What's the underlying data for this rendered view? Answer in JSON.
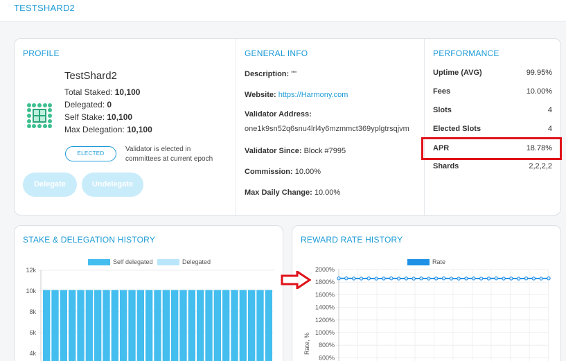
{
  "header": {
    "title": "TESTSHARD2"
  },
  "profile": {
    "section_title": "PROFILE",
    "name": "TestShard2",
    "total_staked_label": "Total Staked:",
    "total_staked": "10,100",
    "delegated_label": "Delegated:",
    "delegated": "0",
    "self_stake_label": "Self Stake:",
    "self_stake": "10,100",
    "max_delegation_label": "Max Delegation:",
    "max_delegation": "10,100",
    "badge": "ELECTED",
    "badge_note": "Validator is elected in committees at current epoch",
    "delegate_button": "Delegate",
    "undelegate_button": "Undelegate",
    "logo_icon": "validator-logo-icon"
  },
  "general_info": {
    "section_title": "GENERAL INFO",
    "description_label": "Description:",
    "description": "\"\"",
    "website_label": "Website:",
    "website": "https://Harmony.com",
    "validator_address_label": "Validator Address:",
    "validator_address": "one1k9sn52q6snu4lrl4y6mzmmct369yplgtrsqjvm",
    "validator_since_label": "Validator Since:",
    "validator_since": "Block #7995",
    "commission_label": "Commission:",
    "commission": "10.00%",
    "max_daily_change_label": "Max Daily Change:",
    "max_daily_change": "10.00%"
  },
  "performance": {
    "section_title": "PERFORMANCE",
    "rows": [
      {
        "label": "Uptime (AVG)",
        "value": "99.95%"
      },
      {
        "label": "Fees",
        "value": "10.00%"
      },
      {
        "label": "Slots",
        "value": "4"
      },
      {
        "label": "Elected Slots",
        "value": "4"
      },
      {
        "label": "APR",
        "value": "18.78%"
      },
      {
        "label": "Shards",
        "value": "2,2,2,2"
      }
    ]
  },
  "stake_history": {
    "section_title": "STAKE & DELEGATION HISTORY",
    "legend": [
      "Self delegated",
      "Delegated"
    ],
    "colors": {
      "self": "#44bdef",
      "delegated": "#b9e6fb"
    },
    "chart_data": {
      "type": "bar",
      "series": [
        {
          "name": "Self delegated",
          "values": [
            10100,
            10100,
            10100,
            10100,
            10100,
            10100,
            10100,
            10100,
            10100,
            10100,
            10100,
            10100,
            10100,
            10100,
            10100,
            10100,
            10100,
            10100,
            10100,
            10100,
            10100,
            10100,
            10100,
            10100,
            10100,
            10100,
            10100
          ]
        },
        {
          "name": "Delegated",
          "values": [
            0,
            0,
            0,
            0,
            0,
            0,
            0,
            0,
            0,
            0,
            0,
            0,
            0,
            0,
            0,
            0,
            0,
            0,
            0,
            0,
            0,
            0,
            0,
            0,
            0,
            0,
            0
          ]
        }
      ],
      "yticks": [
        "12k",
        "10k",
        "8k",
        "6k",
        "4k"
      ],
      "ylim": [
        0,
        12000
      ],
      "stacked": true
    }
  },
  "reward_history": {
    "section_title": "REWARD RATE HISTORY",
    "legend": [
      "Rate"
    ],
    "colors": {
      "rate": "#1e90e6"
    },
    "chart_data": {
      "type": "line",
      "series": [
        {
          "name": "Rate",
          "values": [
            1860,
            1860,
            1858,
            1857,
            1859,
            1856,
            1858,
            1860,
            1857,
            1858,
            1856,
            1859,
            1857,
            1858,
            1860,
            1857,
            1856,
            1858,
            1859,
            1857,
            1858,
            1860,
            1857,
            1858,
            1856,
            1859,
            1858,
            1857,
            1860
          ]
        }
      ],
      "ylabel": "Rate, %",
      "yticks": [
        "2000%",
        "1800%",
        "1600%",
        "1400%",
        "1200%",
        "1000%",
        "800%",
        "600%"
      ],
      "ylim": [
        0,
        2000
      ],
      "grid": true
    }
  },
  "annotations": {
    "arrow_color": "#e0121b",
    "highlight_color": "#e0121b"
  }
}
